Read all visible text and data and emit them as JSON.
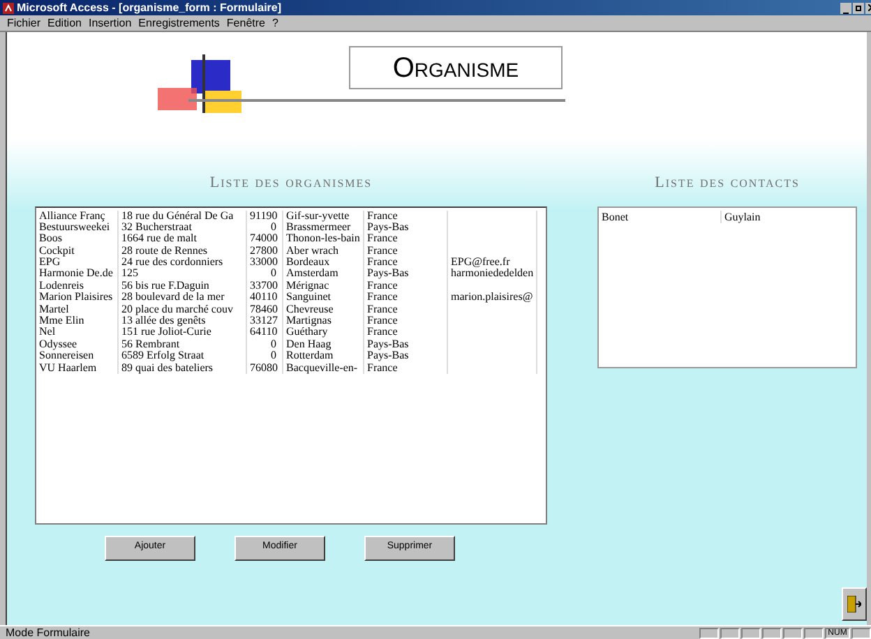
{
  "window": {
    "title": "Microsoft Access - [organisme_form : Formulaire]"
  },
  "menu": [
    "Fichier",
    "Edition",
    "Insertion",
    "Enregistrements",
    "Fenêtre",
    "?"
  ],
  "form": {
    "title": "Organisme",
    "organismes": {
      "heading": "Liste des organismes",
      "rows": [
        {
          "name": "Alliance Franç",
          "address": "18 rue du Général De Ga",
          "postcode": "91190",
          "city": "Gif-sur-yvette",
          "country": "France"
        },
        {
          "name": "Bestuursweekei",
          "address": "32 Bucherstraat",
          "postcode": "0",
          "city": "Brassmermeer",
          "country": "Pays-Bas"
        },
        {
          "name": "Boos",
          "address": "1664 rue de malt",
          "postcode": "74000",
          "city": "Thonon-les-bain",
          "country": "France"
        },
        {
          "name": "Cockpit",
          "address": "28 route de Rennes",
          "postcode": "27800",
          "city": "Aber wrach",
          "country": "France"
        },
        {
          "name": "EPG",
          "address": "24 rue des cordonniers",
          "postcode": "33000",
          "city": "Bordeaux",
          "country": "France",
          "email": "EPG@free.fr"
        },
        {
          "name": "Harmonie De.de",
          "address": "125",
          "postcode": "0",
          "city": "Amsterdam",
          "country": "Pays-Bas",
          "email": "harmoniededelden"
        },
        {
          "name": "Lodenreis",
          "address": "56 bis rue F.Daguin",
          "postcode": "33700",
          "city": "Mérignac",
          "country": "France"
        },
        {
          "name": "Marion Plaisires",
          "address": "28 boulevard de la mer",
          "postcode": "40110",
          "city": "Sanguinet",
          "country": "France",
          "email": "marion.plaisires@"
        },
        {
          "name": "Martel",
          "address": "20 place du marché couv",
          "postcode": "78460",
          "city": "Chevreuse",
          "country": "France"
        },
        {
          "name": "Mme Elin",
          "address": "13 allée des genêts",
          "postcode": "33127",
          "city": "Martignas",
          "country": "France"
        },
        {
          "name": "Nel",
          "address": "151 rue Joliot-Curie",
          "postcode": "64110",
          "city": "Guéthary",
          "country": "France"
        },
        {
          "name": "Odyssee",
          "address": "56 Rembrant",
          "postcode": "0",
          "city": "Den Haag",
          "country": "Pays-Bas"
        },
        {
          "name": "Sonnereisen",
          "address": "6589 Erfolg Straat",
          "postcode": "0",
          "city": "Rotterdam",
          "country": "Pays-Bas"
        },
        {
          "name": "VU Haarlem",
          "address": "89 quai des bateliers",
          "postcode": "76080",
          "city": "Bacqueville-en-",
          "country": "France"
        }
      ]
    },
    "contacts": {
      "heading": "Liste des contacts",
      "rows": [
        {
          "last_name": "Bonet",
          "first_name": "Guylain"
        }
      ]
    },
    "buttons": [
      "Ajouter",
      "Modifier",
      "Supprimer"
    ]
  },
  "status_bar": {
    "mode": "Mode Formulaire",
    "indicator": "NUM"
  }
}
